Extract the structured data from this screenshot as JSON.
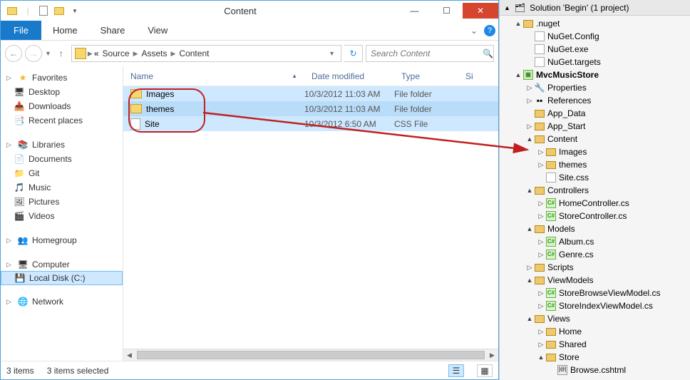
{
  "explorer": {
    "title": "Content",
    "ribbon": {
      "file": "File",
      "tabs": [
        "Home",
        "Share",
        "View"
      ]
    },
    "breadcrumbs": [
      "Source",
      "Assets",
      "Content"
    ],
    "search_placeholder": "Search Content",
    "nav": {
      "favorites": {
        "label": "Favorites",
        "items": [
          "Desktop",
          "Downloads",
          "Recent places"
        ]
      },
      "libraries": {
        "label": "Libraries",
        "items": [
          "Documents",
          "Git",
          "Music",
          "Pictures",
          "Videos"
        ]
      },
      "homegroup": {
        "label": "Homegroup"
      },
      "computer": {
        "label": "Computer",
        "items": [
          "Local Disk (C:)"
        ]
      },
      "network": {
        "label": "Network"
      }
    },
    "columns": {
      "name": "Name",
      "date": "Date modified",
      "type": "Type",
      "size": "Si"
    },
    "rows": [
      {
        "name": "Images",
        "date": "10/3/2012 11:03 AM",
        "type": "File folder",
        "icon": "folder"
      },
      {
        "name": "themes",
        "date": "10/3/2012 11:03 AM",
        "type": "File folder",
        "icon": "folder"
      },
      {
        "name": "Site",
        "date": "10/3/2012 6:50 AM",
        "type": "CSS File",
        "icon": "css"
      }
    ],
    "status": {
      "count": "3 items",
      "selected": "3 items selected"
    }
  },
  "solution": {
    "title": "Solution 'Begin' (1 project)",
    "tree": [
      {
        "d": 0,
        "t": "▲",
        "i": "sln",
        "l": "Solution 'Begin' (1 project)"
      },
      {
        "d": 1,
        "t": "▲",
        "i": "folder",
        "l": ".nuget"
      },
      {
        "d": 2,
        "t": "",
        "i": "cfg",
        "l": "NuGet.Config"
      },
      {
        "d": 2,
        "t": "",
        "i": "cfg",
        "l": "NuGet.exe"
      },
      {
        "d": 2,
        "t": "",
        "i": "cfg",
        "l": "NuGet.targets"
      },
      {
        "d": 1,
        "t": "▲",
        "i": "proj",
        "l": "MvcMusicStore",
        "bold": true
      },
      {
        "d": 2,
        "t": "▷",
        "i": "wrench",
        "l": "Properties"
      },
      {
        "d": 2,
        "t": "▷",
        "i": "ref",
        "l": "References"
      },
      {
        "d": 2,
        "t": "",
        "i": "folder",
        "l": "App_Data"
      },
      {
        "d": 2,
        "t": "▷",
        "i": "folder",
        "l": "App_Start"
      },
      {
        "d": 2,
        "t": "▲",
        "i": "folder",
        "l": "Content"
      },
      {
        "d": 3,
        "t": "▷",
        "i": "folder",
        "l": "Images"
      },
      {
        "d": 3,
        "t": "▷",
        "i": "folder",
        "l": "themes"
      },
      {
        "d": 3,
        "t": "",
        "i": "css",
        "l": "Site.css"
      },
      {
        "d": 2,
        "t": "▲",
        "i": "folder",
        "l": "Controllers"
      },
      {
        "d": 3,
        "t": "▷",
        "i": "cs",
        "l": "HomeController.cs"
      },
      {
        "d": 3,
        "t": "▷",
        "i": "cs",
        "l": "StoreController.cs"
      },
      {
        "d": 2,
        "t": "▲",
        "i": "folder",
        "l": "Models"
      },
      {
        "d": 3,
        "t": "▷",
        "i": "cs",
        "l": "Album.cs"
      },
      {
        "d": 3,
        "t": "▷",
        "i": "cs",
        "l": "Genre.cs"
      },
      {
        "d": 2,
        "t": "▷",
        "i": "folder",
        "l": "Scripts"
      },
      {
        "d": 2,
        "t": "▲",
        "i": "folder",
        "l": "ViewModels"
      },
      {
        "d": 3,
        "t": "▷",
        "i": "cs",
        "l": "StoreBrowseViewModel.cs"
      },
      {
        "d": 3,
        "t": "▷",
        "i": "cs",
        "l": "StoreIndexViewModel.cs"
      },
      {
        "d": 2,
        "t": "▲",
        "i": "folder",
        "l": "Views"
      },
      {
        "d": 3,
        "t": "▷",
        "i": "folder",
        "l": "Home"
      },
      {
        "d": 3,
        "t": "▷",
        "i": "folder",
        "l": "Shared"
      },
      {
        "d": 3,
        "t": "▲",
        "i": "folder",
        "l": "Store"
      },
      {
        "d": 4,
        "t": "",
        "i": "cshtml",
        "l": "Browse.cshtml"
      }
    ]
  }
}
